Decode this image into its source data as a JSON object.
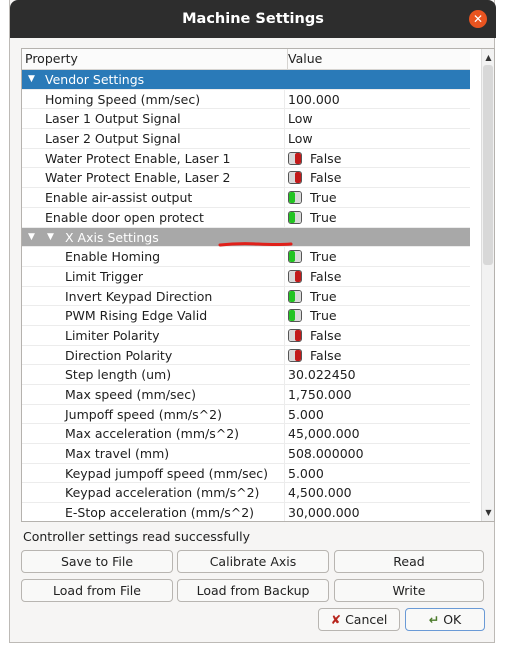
{
  "window": {
    "title": "Machine Settings"
  },
  "table": {
    "headers": {
      "property": "Property",
      "value": "Value"
    },
    "vendor_group": "Vendor Settings",
    "vendor_rows": [
      {
        "name": "Homing Speed (mm/sec)",
        "value": "100.000"
      },
      {
        "name": "Laser 1 Output Signal",
        "value": "Low"
      },
      {
        "name": "Laser 2 Output Signal",
        "value": "Low"
      },
      {
        "name": "Water Protect Enable, Laser 1",
        "value": "False"
      },
      {
        "name": "Water Protect Enable, Laser 2",
        "value": "False"
      },
      {
        "name": "Enable air-assist output",
        "value": "True"
      },
      {
        "name": "Enable door open protect",
        "value": "True"
      }
    ],
    "x_group": "X Axis Settings",
    "x_rows": [
      {
        "name": "Enable Homing",
        "value": "True"
      },
      {
        "name": "Limit Trigger",
        "value": "False"
      },
      {
        "name": "Invert Keypad Direction",
        "value": "True"
      },
      {
        "name": "PWM Rising Edge Valid",
        "value": "True"
      },
      {
        "name": "Limiter Polarity",
        "value": "False"
      },
      {
        "name": "Direction Polarity",
        "value": "False"
      },
      {
        "name": "Step length (um)",
        "value": "30.022450"
      },
      {
        "name": "Max speed (mm/sec)",
        "value": "1,750.000"
      },
      {
        "name": "Jumpoff speed (mm/s^2)",
        "value": "5.000"
      },
      {
        "name": "Max acceleration (mm/s^2)",
        "value": "45,000.000"
      },
      {
        "name": "Max travel (mm)",
        "value": "508.000000"
      },
      {
        "name": "Keypad jumpoff speed (mm/sec)",
        "value": "5.000"
      },
      {
        "name": "Keypad acceleration (mm/s^2)",
        "value": "4,500.000"
      },
      {
        "name": "E-Stop acceleration (mm/s^2)",
        "value": "30,000.000"
      }
    ]
  },
  "status": "Controller settings read successfully",
  "buttons": {
    "save_to_file": "Save to File",
    "calibrate_axis": "Calibrate Axis",
    "read": "Read",
    "load_from_file": "Load from File",
    "load_from_backup": "Load from Backup",
    "write": "Write",
    "cancel": "Cancel",
    "ok": "OK"
  },
  "colors": {
    "selected_group": "#2a7ab8",
    "subgroup": "#a8a8a8",
    "toggle_on": "#22c422",
    "toggle_off": "#c21a1a",
    "close_button": "#e95420"
  }
}
